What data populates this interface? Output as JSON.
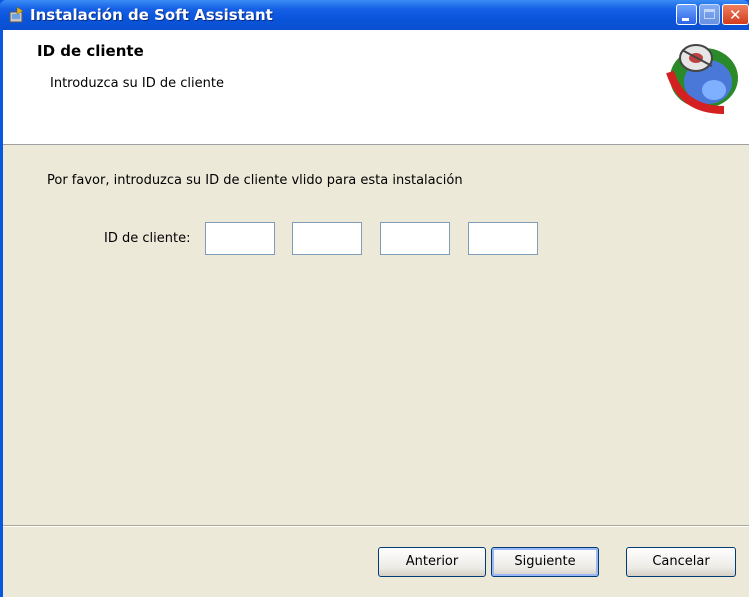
{
  "window": {
    "title": "Instalación de Soft Assistant",
    "icon": "installer-icon",
    "controls": [
      "minimize",
      "maximize",
      "close"
    ]
  },
  "header": {
    "title": "ID de cliente",
    "subtitle": "Introduzca su ID de cliente",
    "logo": "soft-assistant-logo"
  },
  "body": {
    "instruction": "Por favor, introduzca su ID de cliente vlido para esta instalación",
    "id_label": "ID de cliente:",
    "id_fields": [
      {
        "value": "",
        "placeholder": ""
      },
      {
        "value": "",
        "placeholder": ""
      },
      {
        "value": "",
        "placeholder": ""
      },
      {
        "value": "",
        "placeholder": ""
      }
    ]
  },
  "footer": {
    "back_label": "Anterior",
    "next_label": "Siguiente",
    "cancel_label": "Cancelar"
  },
  "colors": {
    "titlebar": "#0a55dc",
    "dialog_background": "#ece9d8",
    "header_background": "#ffffff",
    "close_button": "#d13c1c"
  }
}
